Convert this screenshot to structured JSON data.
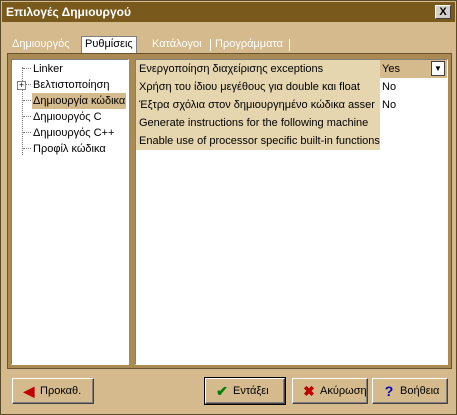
{
  "window": {
    "title": "Επιλογές Δημιουργού",
    "close_label": "X"
  },
  "tabs": [
    {
      "label": "Δημιουργός"
    },
    {
      "label": "Ρυθμίσεις"
    },
    {
      "label": "Κατάλογοι"
    },
    {
      "label": "Προγράμματα"
    }
  ],
  "active_tab": 1,
  "tree": {
    "items": [
      {
        "label": "Linker"
      },
      {
        "label": "Βελτιστοποίηση",
        "expander": "+"
      },
      {
        "label": "Δημιουργία κώδικα"
      },
      {
        "label": "Δημιουργός C"
      },
      {
        "label": "Δημιουργός C++"
      },
      {
        "label": "Προφίλ κώδικα"
      }
    ],
    "selected": 2
  },
  "settings": [
    {
      "label": "Ενεργοποίηση διαχείρισης exceptions",
      "value": "Yes"
    },
    {
      "label": "Χρήση του ίδιου μεγέθους για double και float",
      "value": "No"
    },
    {
      "label": "Έξτρα σχόλια στον δημιουργημένο κώδικα asser",
      "value": "No"
    },
    {
      "label": "Generate instructions for the following machine",
      "value": ""
    },
    {
      "label": "Enable use of processor specific built-in functions",
      "value": ""
    }
  ],
  "buttons": {
    "back": {
      "label": "Προκαθ.",
      "icon": "arrow-left-icon"
    },
    "ok": {
      "label": "Εντάξει",
      "icon": "check-icon"
    },
    "cancel": {
      "label": "Ακύρωση",
      "icon": "x-icon"
    },
    "help": {
      "label": "Βοήθεια",
      "icon": "question-icon"
    }
  },
  "colors": {
    "title_bar": "#7a5a1c",
    "dialog_bg": "#d4ba8c",
    "selected_bg": "#d4ba8c",
    "check_green": "#008000",
    "cancel_red": "#c00000",
    "back_red": "#c00000",
    "help_blue": "#0000c0"
  }
}
